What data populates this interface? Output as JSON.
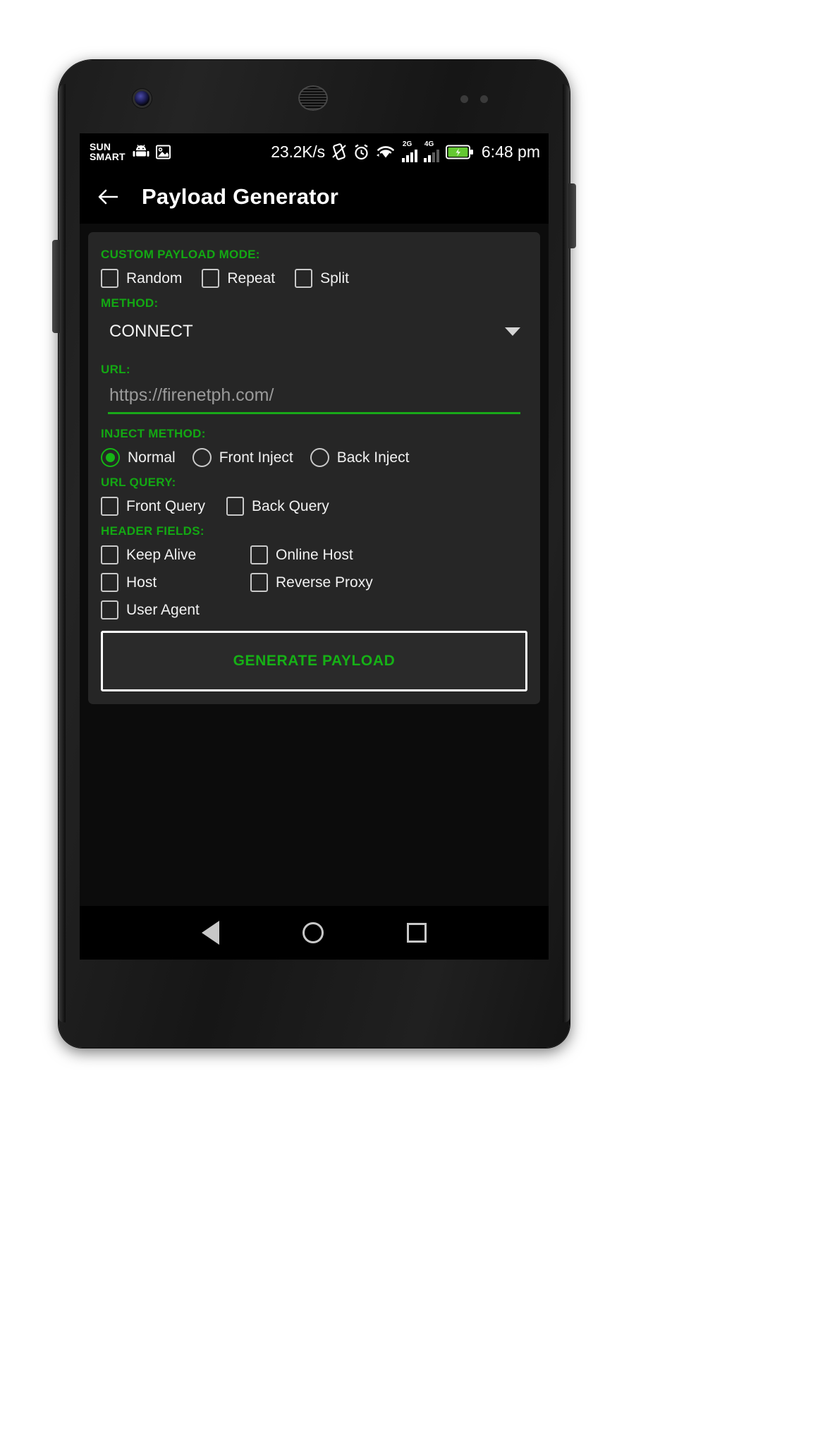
{
  "status_bar": {
    "carrier_line1": "SUN",
    "carrier_line2": "SMART",
    "icons": [
      "android-icon",
      "screenshot-icon",
      "vibrate-icon",
      "alarm-icon",
      "wifi-icon"
    ],
    "net_speed": "23.2K/s",
    "sim1_label": "2G",
    "sim1_bars": 3,
    "sim2_label": "4G",
    "sim2_bars": 2,
    "battery_charging": true,
    "battery_color": "#64c832",
    "clock": "6:48 pm"
  },
  "app_bar": {
    "back_icon": "arrow-left-icon",
    "title": "Payload Generator"
  },
  "form": {
    "custom_payload_mode": {
      "label": "CUSTOM PAYLOAD MODE:",
      "options": [
        {
          "label": "Random",
          "checked": false
        },
        {
          "label": "Repeat",
          "checked": false
        },
        {
          "label": "Split",
          "checked": false
        }
      ]
    },
    "method": {
      "label": "METHOD:",
      "value": "CONNECT",
      "caret_icon": "chevron-down-icon"
    },
    "url": {
      "label": "URL:",
      "value": "",
      "placeholder": "https://firenetph.com/"
    },
    "inject_method": {
      "label": "INJECT METHOD:",
      "options": [
        {
          "label": "Normal",
          "selected": true
        },
        {
          "label": "Front Inject",
          "selected": false
        },
        {
          "label": "Back Inject",
          "selected": false
        }
      ]
    },
    "url_query": {
      "label": "URL QUERY:",
      "options": [
        {
          "label": "Front Query",
          "checked": false
        },
        {
          "label": "Back Query",
          "checked": false
        }
      ]
    },
    "header_fields": {
      "label": "HEADER FIELDS:",
      "options": [
        {
          "label": "Keep Alive",
          "checked": false
        },
        {
          "label": "Online Host",
          "checked": false
        },
        {
          "label": "Host",
          "checked": false
        },
        {
          "label": "Reverse Proxy",
          "checked": false
        },
        {
          "label": "User Agent",
          "checked": false
        }
      ]
    },
    "generate_button": "GENERATE PAYLOAD"
  },
  "navigation_bar": {
    "back": "nav-back-icon",
    "home": "nav-home-icon",
    "recents": "nav-recents-icon"
  },
  "colors": {
    "accent_green": "#13a813",
    "card_bg": "#262626",
    "screen_bg": "#0c0c0c",
    "text_primary": "#f1f1f1"
  }
}
